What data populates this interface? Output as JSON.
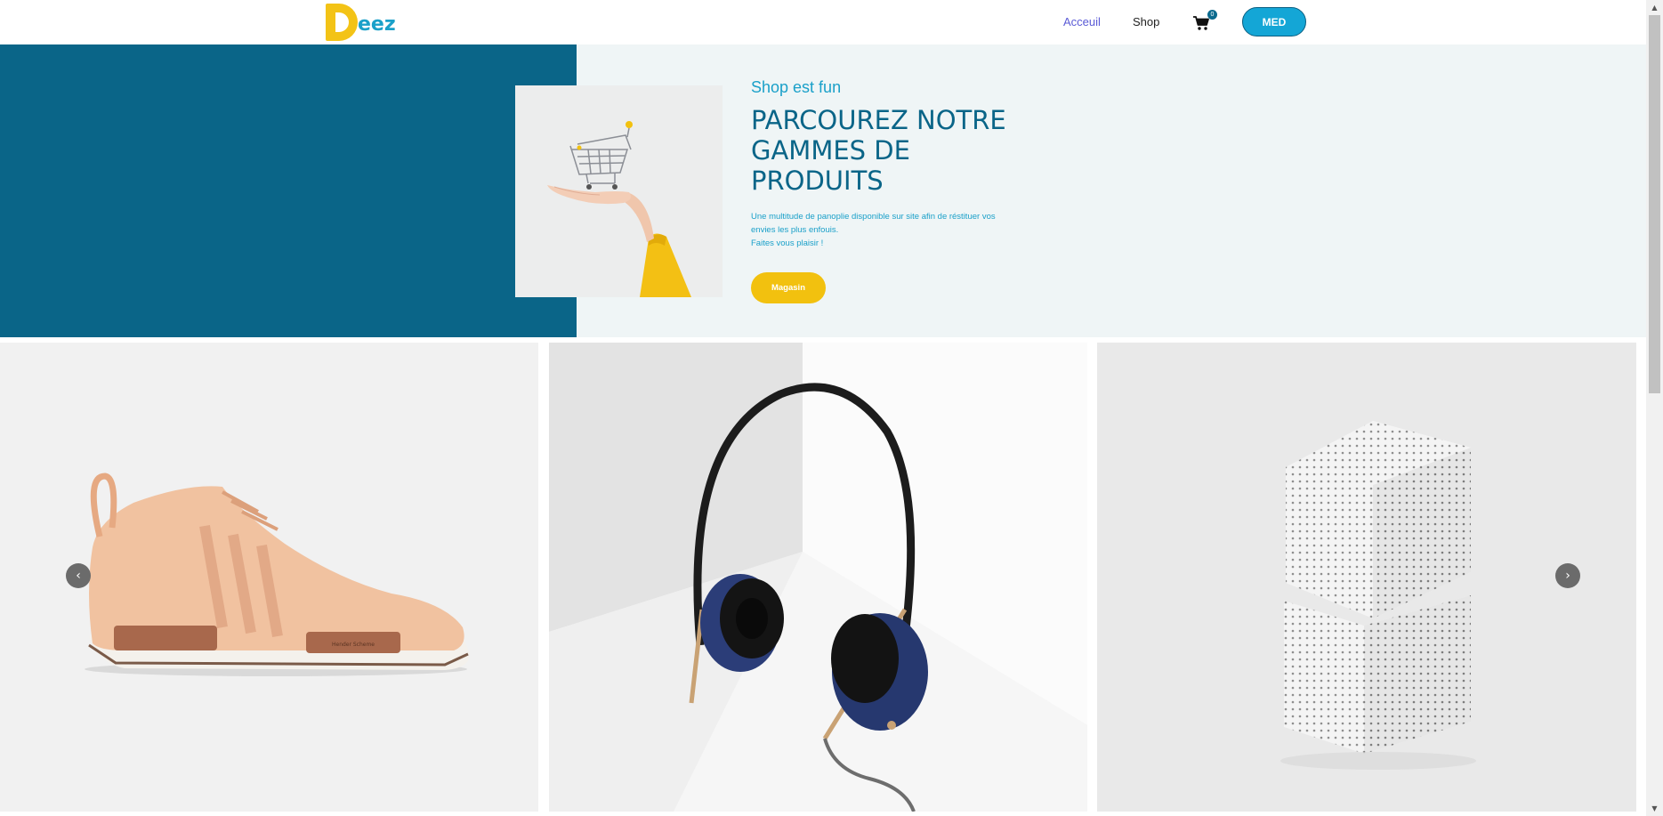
{
  "header": {
    "logo_text": "eez",
    "nav": {
      "accueil": "Acceuil",
      "shop": "Shop"
    },
    "cart": {
      "icon": "cart-icon",
      "count": "0"
    },
    "user_button": "MED"
  },
  "hero": {
    "subtitle": "Shop est fun",
    "title": "PARCOUREZ NOTRE GAMMES DE PRODUITS",
    "description_lines": [
      "Une multitude de panoplie disponible sur site afin de réstituer vos",
      "envies les plus enfouis.",
      "Faites vous plaisir !"
    ],
    "button": "Magasin",
    "image": "shopping-cart-on-hand-photo"
  },
  "carousel": {
    "slides": [
      {
        "image": "beige-sneaker-photo",
        "shoe_label": "Hender Scheme"
      },
      {
        "image": "blue-headphones-photo"
      },
      {
        "image": "perforated-white-cubes-photo"
      }
    ],
    "prev_icon": "chevron-left-icon",
    "next_icon": "chevron-right-icon"
  },
  "colors": {
    "primary_blue": "#0a6588",
    "accent_cyan": "#1aa0c9",
    "accent_yellow": "#f2c10f",
    "hero_bg": "#eff5f6"
  }
}
